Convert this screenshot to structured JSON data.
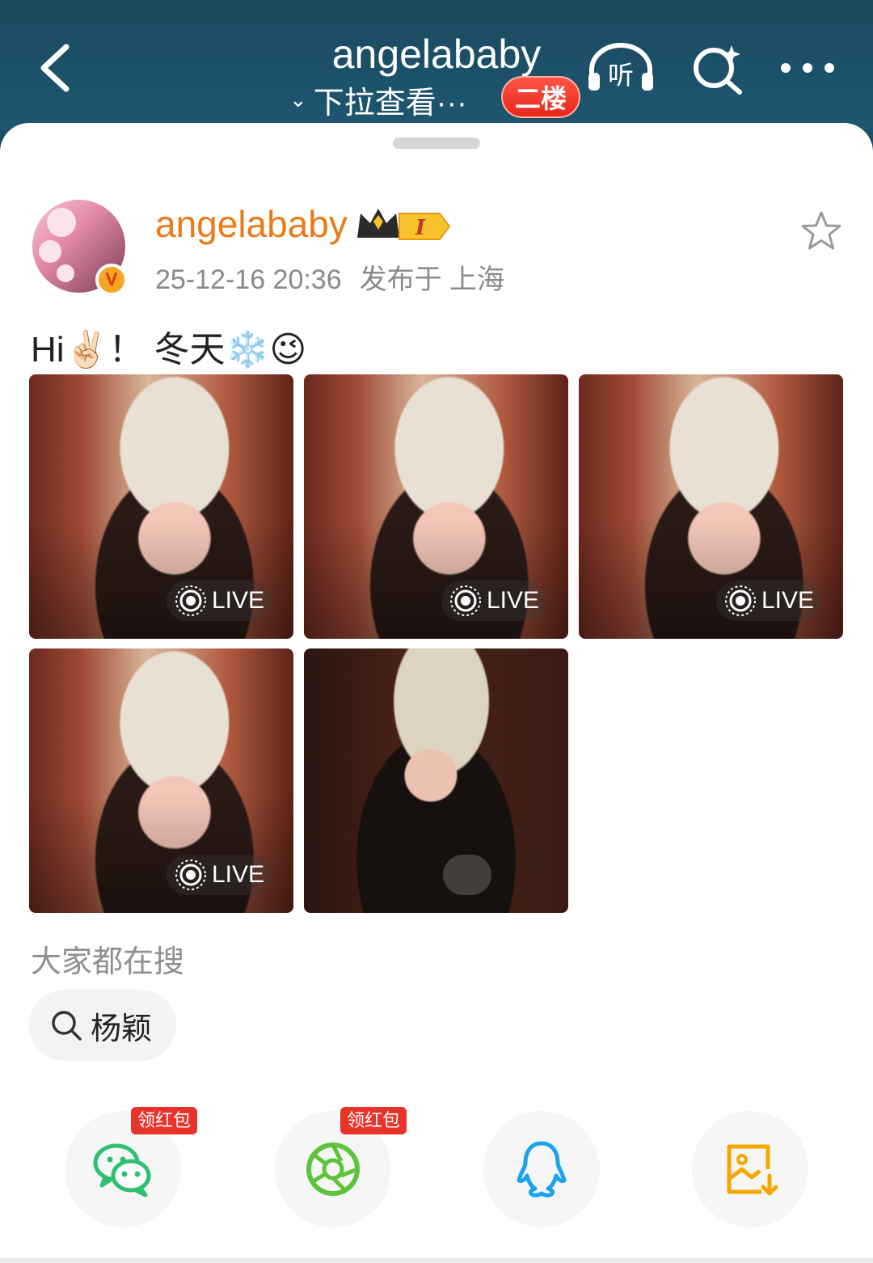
{
  "header": {
    "title": "angelababy",
    "subtitle": "下拉查看···",
    "floor_badge": "二楼",
    "listen_label": "听"
  },
  "post": {
    "username": "angelababy",
    "level_badge": "I",
    "timestamp": "25-12-16 20:36",
    "location": "发布于 上海",
    "text": "Hi✌🏻！ 冬天❄️😉",
    "images": [
      {
        "live_label": "LIVE"
      },
      {
        "live_label": "LIVE"
      },
      {
        "live_label": "LIVE"
      },
      {
        "live_label": "LIVE"
      },
      {
        "live_label": ""
      }
    ]
  },
  "hot_search": {
    "label": "大家都在搜",
    "chip": "杨颖"
  },
  "share": {
    "wechat_badge": "领红包",
    "moments_badge": "领红包"
  },
  "colors": {
    "header_bg": "#1a4a60",
    "username": "#ec7a18",
    "wechat": "#2fbf71",
    "moments": "#5cc33b",
    "qq": "#1ba3f0",
    "save": "#f7a600",
    "badge_red": "#e8332a"
  }
}
